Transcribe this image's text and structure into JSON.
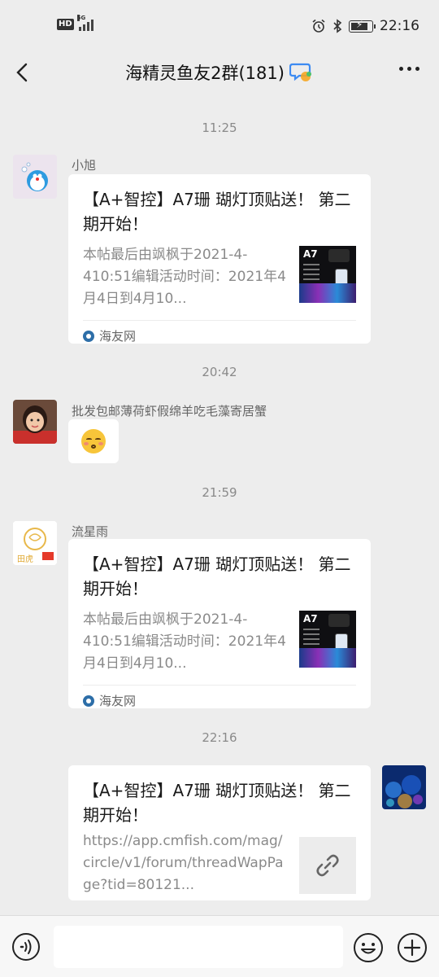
{
  "status_bar": {
    "hd_label": "HD",
    "network_label": "5G",
    "time": "22:16",
    "icons": [
      "alarm-icon",
      "bluetooth-icon",
      "battery-icon"
    ],
    "battery_level": 0.85
  },
  "header": {
    "back_icon": "chevron-left-icon",
    "title": "海精灵鱼友2群(181)",
    "title_icon": "chat-bubbles-icon",
    "more_icon": "more-dots-icon"
  },
  "messages": [
    {
      "timestamp": "11:25",
      "sender": "小旭",
      "card": {
        "title": "【A+智控】A7珊 瑚灯顶贴送！ 第二期开始！",
        "description": "本帖最后由飒枫于2021-4-410:51编辑活动时间：2021年4月4日到4月10...",
        "source": "海友网",
        "thumb_label": "A7"
      }
    },
    {
      "timestamp": "20:42",
      "sender": "批发包邮薄荷虾假绵羊吃毛藻寄居蟹",
      "emoji": "kissing-face-emoji"
    },
    {
      "timestamp": "21:59",
      "sender": "流星雨",
      "avatar_text": "田虎",
      "card": {
        "title": "【A+智控】A7珊 瑚灯顶贴送！ 第二期开始！",
        "description": "本帖最后由飒枫于2021-4-410:51编辑活动时间：2021年4月4日到4月10...",
        "source": "海友网",
        "thumb_label": "A7"
      }
    },
    {
      "timestamp": "22:16",
      "sender": "",
      "card": {
        "title": "【A+智控】A7珊 瑚灯顶贴送！ 第二期开始！",
        "description": "https://app.cmfish.com/mag/circle/v1/forum/threadWapPage?tid=80121...",
        "link_icon": "link-icon"
      }
    }
  ],
  "input_bar": {
    "voice_icon": "voice-icon",
    "placeholder": "",
    "emoji_icon": "emoji-icon",
    "plus_icon": "plus-icon"
  },
  "colors": {
    "background": "#ededed",
    "bubble": "#ffffff",
    "timestamp": "#8a8a8a",
    "title_icon_blue": "#3d8bf2",
    "title_icon_orange": "#f5a623"
  }
}
